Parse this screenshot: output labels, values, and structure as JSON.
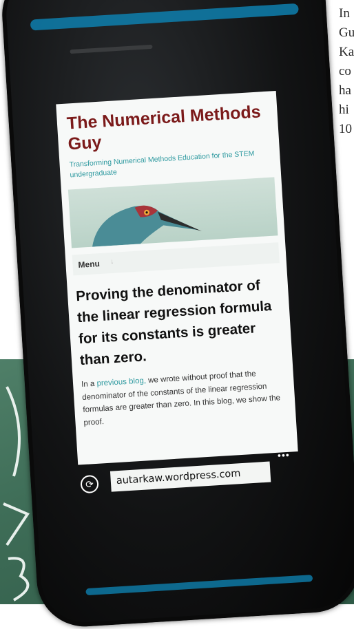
{
  "background_text": [
    "In",
    "Gu",
    "Ka",
    "co",
    "ha",
    "hi",
    "10"
  ],
  "site": {
    "title": "The Numerical Methods Guy",
    "tagline": "Transforming Numerical Methods Education for the STEM undergraduate"
  },
  "menu": {
    "label": "Menu",
    "caret": "↓"
  },
  "post": {
    "title": "Proving the denominator of the linear regression formula for its constants is greater than zero.",
    "body_prefix": "In a ",
    "link_text": "previous blog,",
    "body_suffix": " we wrote without proof that the denominator of the constants of the linear regression formulas are greater than zero.  In this blog, we show the proof."
  },
  "browser": {
    "url": "autarkaw.wordpress.com",
    "refresh_icon": "refresh-icon",
    "more_icon": "more-icon",
    "more_glyph": "•••",
    "refresh_glyph": "⟳"
  },
  "colors": {
    "title": "#7b1a1a",
    "tagline": "#2f9aa0",
    "link": "#2f9aa0",
    "phone_accent": "#0e7fae",
    "chalkboard": "#3f6e58"
  }
}
